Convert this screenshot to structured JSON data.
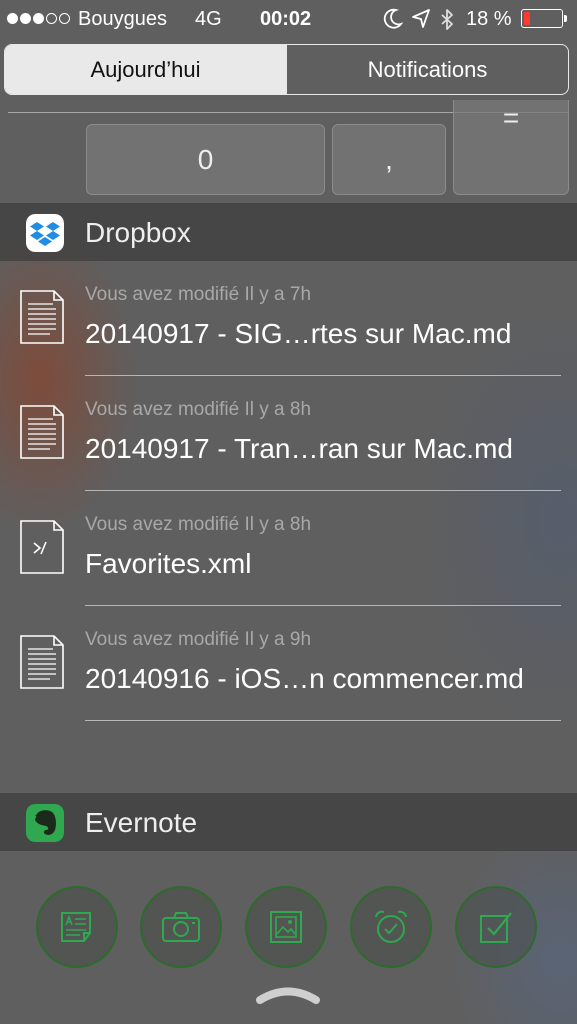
{
  "status_bar": {
    "carrier": "Bouygues",
    "network": "4G",
    "time": "00:02",
    "battery_text": "18 %",
    "battery_level": 0.18,
    "signal_bars": 3,
    "signal_total": 5,
    "icons": [
      "moon-icon",
      "location-arrow-icon",
      "bluetooth-icon",
      "battery-icon"
    ]
  },
  "segmented": {
    "today_label": "Aujourd’hui",
    "notifications_label": "Notifications",
    "selected": "today"
  },
  "calculator": {
    "key_zero": "0",
    "key_comma": ",",
    "key_equals": "="
  },
  "dropbox": {
    "title": "Dropbox",
    "items": [
      {
        "subtitle": "Vous avez modifié Il y a 7h",
        "title": "20140917 - SIG…rtes sur Mac.md",
        "icon": "text-document-icon"
      },
      {
        "subtitle": "Vous avez modifié Il y a 8h",
        "title": "20140917 - Tran…ran sur Mac.md",
        "icon": "text-document-icon"
      },
      {
        "subtitle": "Vous avez modifié Il y a 8h",
        "title": "Favorites.xml",
        "icon": "code-document-icon"
      },
      {
        "subtitle": "Vous avez modifié Il y a 9h",
        "title": "20140916 - iOS…n commencer.md",
        "icon": "text-document-icon"
      }
    ]
  },
  "evernote": {
    "title": "Evernote",
    "buttons": [
      "text-note-icon",
      "camera-icon",
      "photo-icon",
      "reminder-alarm-icon",
      "checklist-icon"
    ]
  },
  "colors": {
    "background": "#5f5f5f",
    "evernote_green": "#2fa84f",
    "dropbox_blue": "#1f8ce6",
    "battery_red": "#ff3b30"
  }
}
